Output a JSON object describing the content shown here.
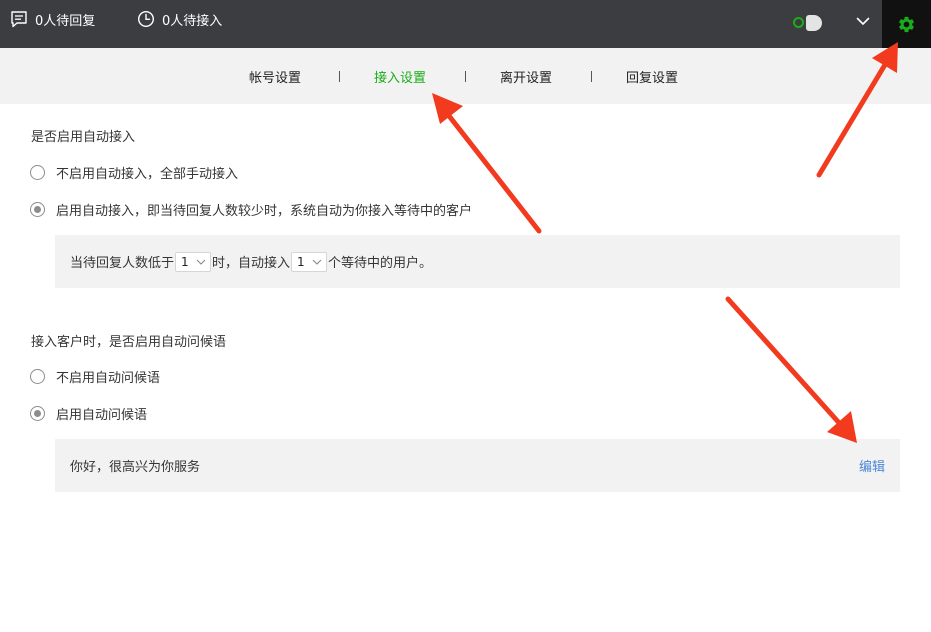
{
  "header": {
    "pending_reply": "0人待回复",
    "pending_accept": "0人待接入",
    "icons": {
      "reply": "chat-bubble-icon",
      "accept": "clock-icon",
      "status": "online-status-toggle",
      "menu": "chevron-down-icon",
      "settings": "gear-icon"
    },
    "colors": {
      "bar": "#3b3d40",
      "settings_bg": "#111111",
      "accent": "#1aad19"
    }
  },
  "tabs": [
    {
      "label": "帐号设置",
      "active": false
    },
    {
      "label": "接入设置",
      "active": true
    },
    {
      "label": "离开设置",
      "active": false
    },
    {
      "label": "回复设置",
      "active": false
    }
  ],
  "tab_separator": "|",
  "auto_accept": {
    "title": "是否启用自动接入",
    "options": [
      {
        "label": "不启用自动接入，全部手动接入",
        "checked": false
      },
      {
        "label": "启用自动接入，即当待回复人数较少时，系统自动为你接入等待中的客户",
        "checked": true
      }
    ],
    "rule": {
      "text1": "当待回复人数低于",
      "value1": "1",
      "text2": "时，自动接入",
      "value2": "1",
      "text3": "个等待中的用户。"
    }
  },
  "greeting": {
    "title": "接入客户时，是否启用自动问候语",
    "options": [
      {
        "label": "不启用自动问候语",
        "checked": false
      },
      {
        "label": "启用自动问候语",
        "checked": true
      }
    ],
    "message": "你好，很高兴为你服务",
    "edit_label": "编辑"
  },
  "annotation_color": "#f23a1e"
}
